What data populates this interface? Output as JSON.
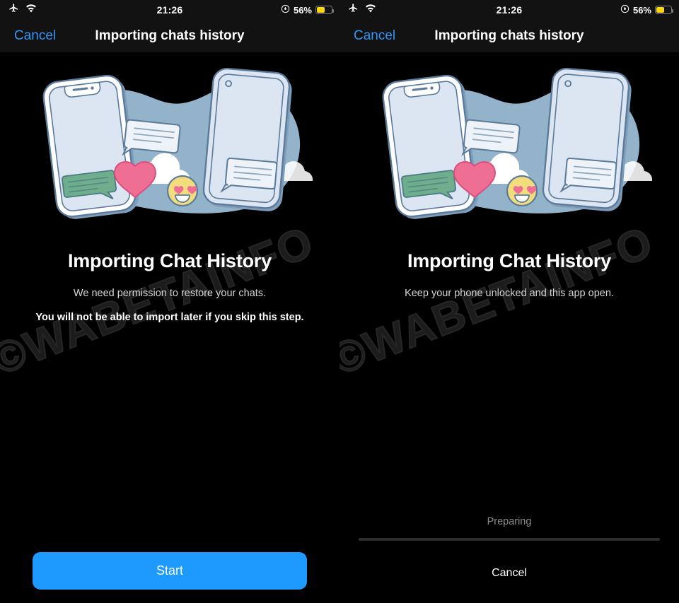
{
  "status_bar": {
    "airplane_icon": "airplane-icon",
    "wifi_icon": "wifi-icon",
    "time": "21:26",
    "location_icon": "location-services-icon",
    "battery_percent": "56%",
    "battery_level": 56,
    "battery_color": "#ffd60a"
  },
  "nav_bar": {
    "cancel_label": "Cancel",
    "title": "Importing chats history",
    "cancel_color": "#2f97f5"
  },
  "watermark": {
    "text": "©WABETAINFO"
  },
  "illustration": {
    "name": "two-phones-chat-sync-illustration",
    "blob_color": "#93b3ca",
    "phone_body": "#e2ebf5",
    "phone_outline": "#5c7a99",
    "phone_frame": "#ffffff",
    "bubble_outgoing": "#6fae8d",
    "bubble_incoming": "#eef3f9",
    "heart_color": "#ef6f94",
    "emoji_color": "#f2dd7e",
    "cloud_color": "#ffffff"
  },
  "panels": [
    {
      "id": "permission-step",
      "headline": "Importing Chat History",
      "subline": "We need permission to restore your chats.",
      "warning": "You will not be able to import later if you skip this step.",
      "primary_button": "Start",
      "primary_button_color": "#1e9afe"
    },
    {
      "id": "progress-step",
      "headline": "Importing Chat History",
      "subline": "Keep your phone unlocked and this app open.",
      "progress_label": "Preparing",
      "progress_percent": 0,
      "cancel_label": "Cancel"
    }
  ]
}
